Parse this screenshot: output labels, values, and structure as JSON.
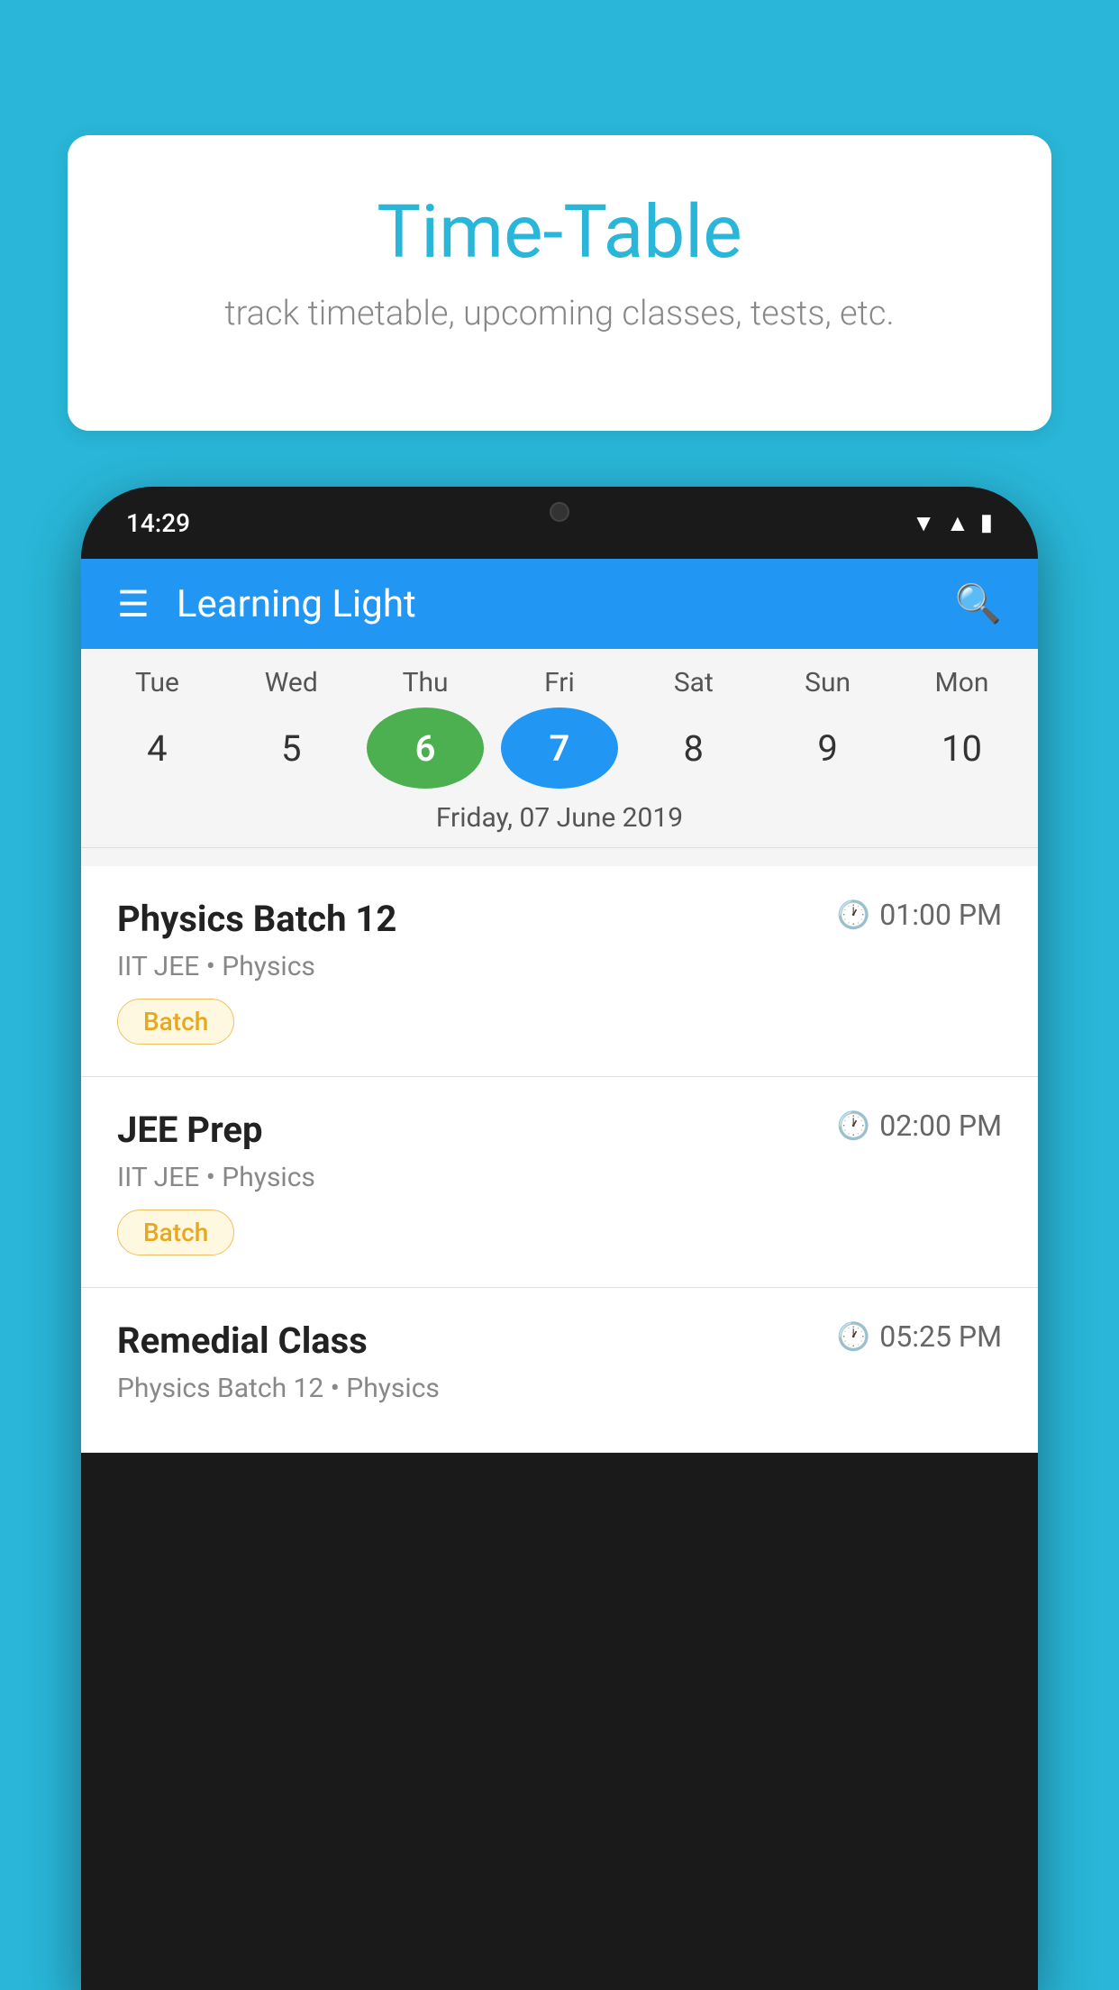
{
  "background_color": "#29B6D8",
  "speech_bubble": {
    "title": "Time-Table",
    "subtitle": "track timetable, upcoming classes, tests, etc."
  },
  "phone": {
    "status_bar": {
      "time": "14:29"
    },
    "app_bar": {
      "title": "Learning Light"
    },
    "calendar": {
      "days": [
        {
          "name": "Tue",
          "number": "4",
          "state": "normal"
        },
        {
          "name": "Wed",
          "number": "5",
          "state": "normal"
        },
        {
          "name": "Thu",
          "number": "6",
          "state": "today-green"
        },
        {
          "name": "Fri",
          "number": "7",
          "state": "selected-blue"
        },
        {
          "name": "Sat",
          "number": "8",
          "state": "normal"
        },
        {
          "name": "Sun",
          "number": "9",
          "state": "normal"
        },
        {
          "name": "Mon",
          "number": "10",
          "state": "normal"
        }
      ],
      "selected_date_label": "Friday, 07 June 2019"
    },
    "events": [
      {
        "title": "Physics Batch 12",
        "time": "01:00 PM",
        "subtitle": "IIT JEE • Physics",
        "tag": "Batch"
      },
      {
        "title": "JEE Prep",
        "time": "02:00 PM",
        "subtitle": "IIT JEE • Physics",
        "tag": "Batch"
      },
      {
        "title": "Remedial Class",
        "time": "05:25 PM",
        "subtitle": "Physics Batch 12 • Physics",
        "tag": null
      }
    ]
  },
  "icons": {
    "hamburger": "☰",
    "search": "🔍",
    "clock": "🕐",
    "wifi": "▲",
    "signal": "▲",
    "battery": "▮"
  }
}
